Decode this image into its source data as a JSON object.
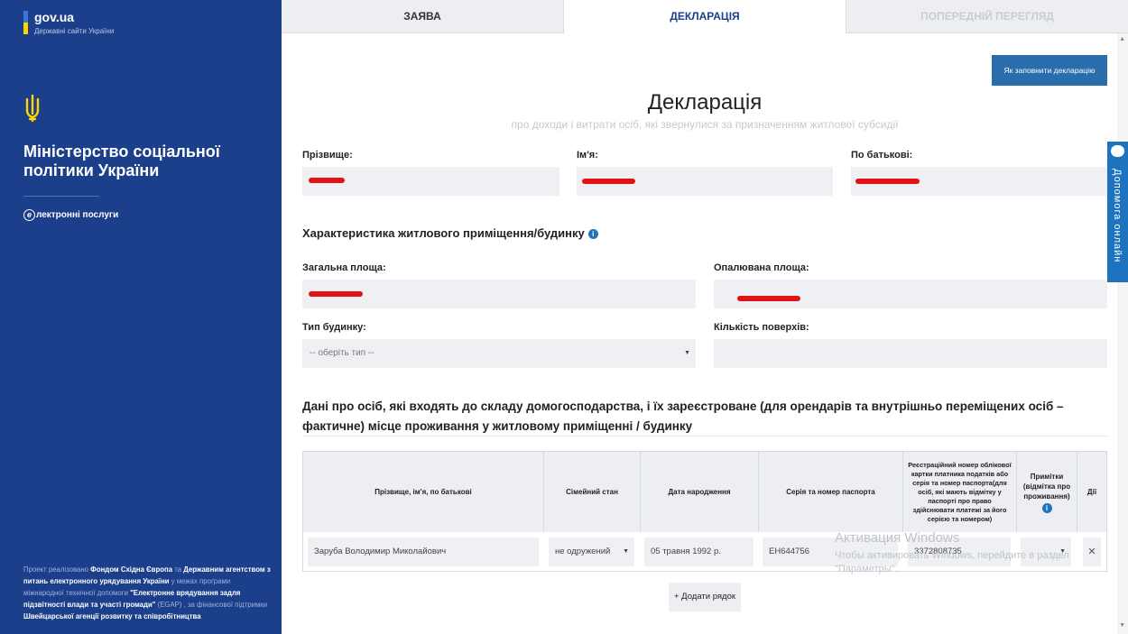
{
  "sidebar": {
    "gov_name": "gov.ua",
    "gov_sub": "Державні сайти України",
    "ministry": "Міністерство соціальної політики України",
    "eservices": "лектронні послуги",
    "eservices_letter": "е",
    "footer": {
      "p1": "Проект реалізовано ",
      "b1": "Фондом Східна Європа",
      "p2": " та ",
      "b2": "Державним агентством з питань електронного урядування України",
      "p3": " у межах програми міжнародної технічної допомоги ",
      "b3": "\"Електронне врядування задля підзвітності влади та участі громади\"",
      "p4": " (EGAP) , за фінансової підтримки ",
      "b4": "Швейцарської агенції розвитку та співробітництва"
    }
  },
  "tabs": [
    {
      "label": "ЗАЯВА"
    },
    {
      "label": "ДЕКЛАРАЦІЯ"
    },
    {
      "label": "ПОПЕРЕДНІЙ ПЕРЕГЛЯД"
    }
  ],
  "guide_button": "Як заповнити декларацію",
  "help": "Допомога онлайн",
  "page": {
    "title": "Декларація",
    "subtitle": "про доходи і витрати осіб, які звернулися за призначенням житлової субсидії"
  },
  "person": {
    "surname_label": "Прізвище:",
    "name_label": "Ім'я:",
    "patronymic_label": "По батькові:"
  },
  "housing": {
    "heading": "Характеристика житлового приміщення/будинку",
    "total_area_label": "Загальна площа:",
    "heated_area_label": "Опалювана площа:",
    "building_type_label": "Тип будинку:",
    "building_type_value": "-- оберіть тип --",
    "floors_label": "Кількість поверхів:"
  },
  "household": {
    "heading": "Дані про осіб, які входять до складу домогосподарства, і їх зареєстроване (для орендарів та внутрішньо переміщених осіб – фактичне) місце проживання у житловому приміщенні / будинку",
    "columns": [
      "Прізвище, ім'я, по батькові",
      "Сімейний стан",
      "Дата народження",
      "Серія та номер паспорта",
      "Реєстраційний номер облікової картки платника податків або серія та номер паспорта(для осіб, які мають відмітку у паспорті про право здійснювати платежі за його серією та номером)",
      "Примітки (відмітка про проживання)",
      "Дії"
    ],
    "rows": [
      {
        "full_name": "Заруба  Володимир Миколайович",
        "marital": "не одружений",
        "birth": "05 травня 1992 р.",
        "passport": "ЕН644756",
        "tax_id": "3372808735",
        "notes": ""
      }
    ],
    "add_row": "+ Додати рядок"
  },
  "watermark": {
    "line1": "Активация Windows",
    "line2": "Чтобы активировать Windows, перейдите в раздел \"Параметры\"."
  },
  "colors": {
    "sidebar": "#1b3f8b",
    "accent": "#1e73be",
    "redaction": "#e01414"
  }
}
